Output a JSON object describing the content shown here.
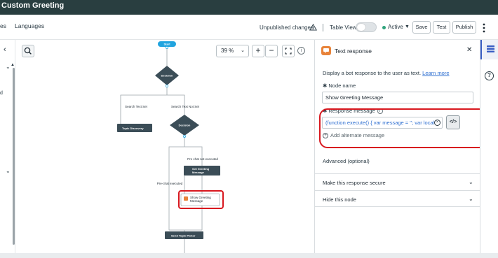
{
  "header": {
    "title": "Custom Greeting"
  },
  "toolbar": {
    "prev_tab_fragment": "es",
    "languages_tab": "Languages",
    "unpublished": "Unpublished changes",
    "table_view": "Table View",
    "status": "Active",
    "save": "Save",
    "test": "Test",
    "publish": "Publish"
  },
  "canvas": {
    "zoom": "39 %",
    "zoom_in": "+",
    "zoom_out": "−",
    "info": "i",
    "flow": {
      "start": "Start",
      "decision1": "Decision",
      "decision2": "Decision",
      "branch_left": "Search Text Set",
      "branch_right": "Search Text Not Set",
      "topic_discovery": "Topic Discovery",
      "prechat_not_executed": "Pre chat not executed",
      "prechat_executed": "Pre-chat executed",
      "get_greeting_line1": "Get Greeting",
      "get_greeting_line2": "Message",
      "show_greeting_line1": "Show Greeting",
      "show_greeting_line2": "Message",
      "send_topic_picker": "Send Topic Picker"
    }
  },
  "panel": {
    "title": "Text response",
    "description": "Display a bot response to the user as text.",
    "learn_more": "Learn more",
    "node_name_label": "Node name",
    "node_name_value": "Show Greeting Message",
    "response_label": "Response message",
    "response_value": "(function execute() { var message = ''; var localD",
    "code_button": "</>",
    "add_alternate": "Add alternate message",
    "advanced": "Advanced (optional)",
    "secure": "Make this response secure",
    "hide": "Hide this node"
  },
  "colors": {
    "title_bar": "#293e40",
    "node_dark": "#3b4d57",
    "text_response_icon": "#e8833a",
    "annotation_red": "#d8171e",
    "link_blue": "#2e6fd1",
    "active_green": "#2fa37c"
  }
}
